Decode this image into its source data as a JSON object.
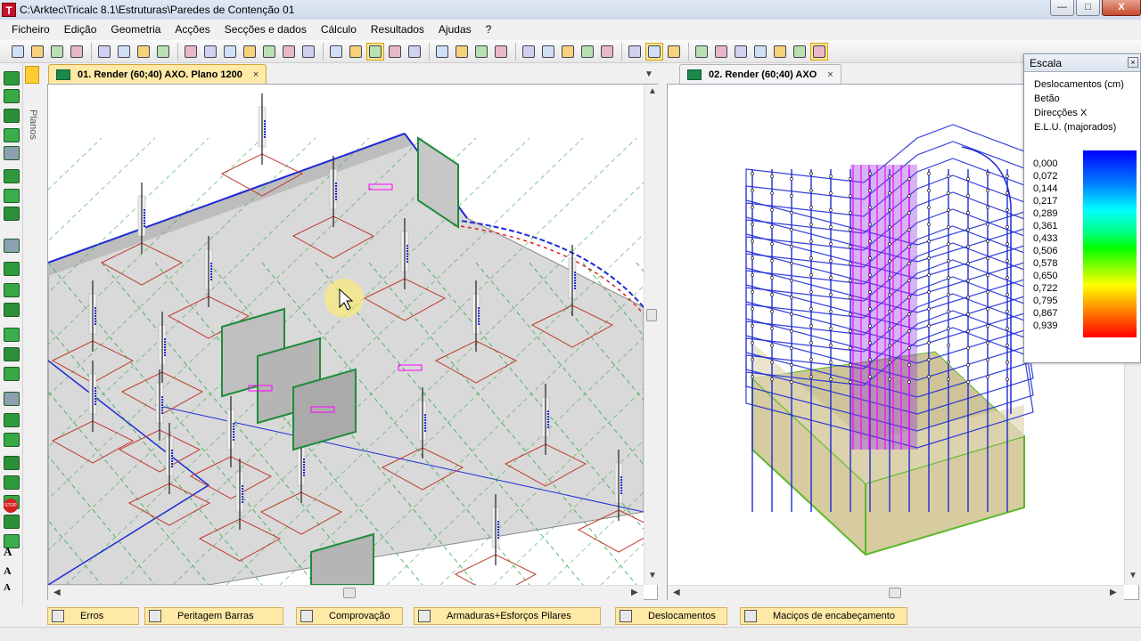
{
  "window": {
    "title": "C:\\Arktec\\Tricalc 8.1\\Estruturas\\Paredes de Contenção 01",
    "app_icon_letter": "T",
    "buttons": {
      "minimize": "—",
      "maximize": "□",
      "close": "X"
    }
  },
  "menu": [
    "Ficheiro",
    "Edição",
    "Geometria",
    "Acções",
    "Secções e dados",
    "Cálculo",
    "Resultados",
    "Ajudas",
    "?"
  ],
  "toolbar": {
    "icons": [
      "save-icon",
      "import-icon",
      "export-icon",
      "flag-icon",
      "render-icon",
      "wireframe-icon",
      "grid-icon",
      "layers-icon",
      "zoom-in-icon",
      "zoom-out-icon",
      "zoom-window-icon",
      "zoom-prev-icon",
      "zoom-all-icon",
      "zoom-fit-icon",
      "cube-icon",
      "select-icon",
      "move-icon",
      "highlighted-icon",
      "rotate-icon",
      "pointer-icon",
      "beam-icon",
      "column-icon",
      "slab-icon",
      "wall-icon",
      "pencil-icon",
      "stairs-icon",
      "mesh-icon",
      "section-icon",
      "lines-icon",
      "refresh-icon",
      "toggle-a-icon",
      "toggle-b-icon",
      "dxf-3d-icon",
      "dwg-icon",
      "dwg2-icon",
      "dwg3-icon",
      "dwg4-icon",
      "bmp-icon",
      "report-icon"
    ],
    "highlighted": [
      "highlighted-icon",
      "toggle-a-icon",
      "report-icon"
    ]
  },
  "left_panel": {
    "label": "Planos"
  },
  "left_tools": {
    "letters": [
      "A",
      "A",
      "A"
    ],
    "stop": "STOP"
  },
  "pane_left": {
    "tab_label": "01. Render (60;40)  AXO. Plano 1200",
    "close": "×",
    "menu_arrow": "▼"
  },
  "pane_right": {
    "tab_label": "02. Render (60;40)  AXO",
    "close": "×",
    "menu_arrow": "▼"
  },
  "legend": {
    "title": "Escala",
    "close": "×",
    "lines": [
      "Deslocamentos (cm)",
      "Betão",
      "Direcções X",
      "E.L.U. (majorados)"
    ],
    "values": [
      "0,000",
      "0,072",
      "0,144",
      "0,217",
      "0,289",
      "0,361",
      "0,433",
      "0,506",
      "0,578",
      "0,650",
      "0,722",
      "0,795",
      "0,867",
      "0,939"
    ]
  },
  "bottom_tabs": [
    "Erros",
    "Peritagem Barras",
    "Comprovação",
    "Armaduras+Esforços Pilares",
    "Deslocamentos",
    "Maciços de encabeçamento"
  ],
  "colors": {
    "tab_active": "#ffe9a6",
    "slab": "#d9d9d9",
    "beam": "#1e2bd6",
    "column": "#222222",
    "magenta": "#ff00ff",
    "red_lines": "#c0392b",
    "green": "#38b22e",
    "foundation": "#c9bb8e"
  }
}
